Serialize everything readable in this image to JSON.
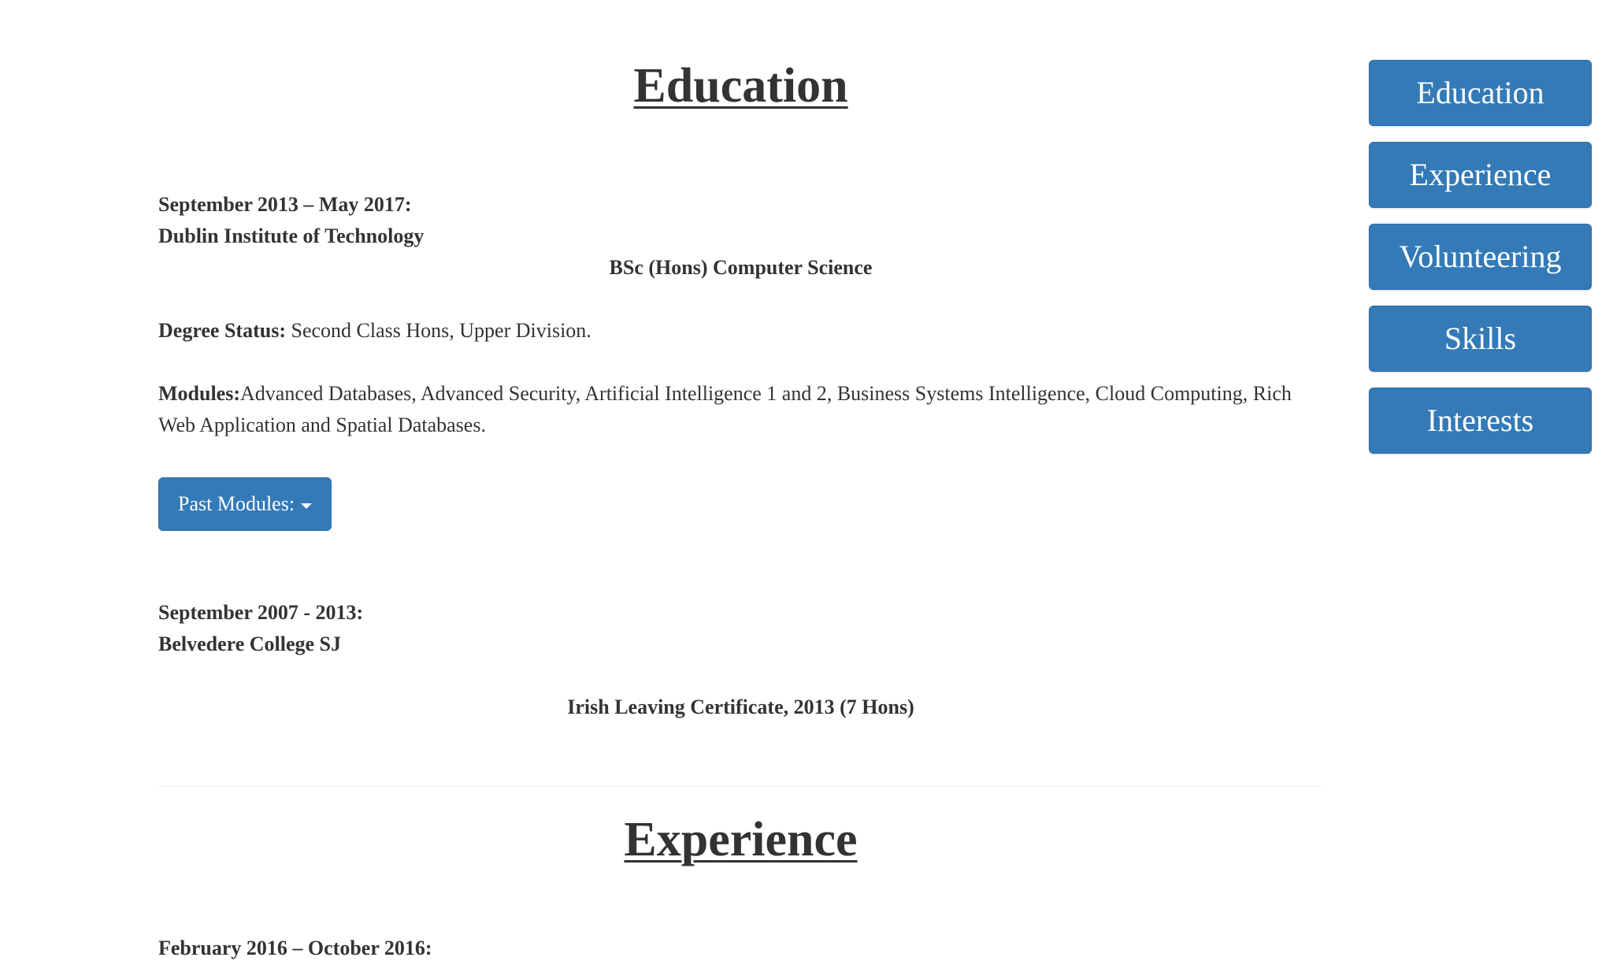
{
  "education": {
    "title": "Education",
    "entry1": {
      "date": "September 2013 – May 2017:",
      "institution": "Dublin Institute of Technology",
      "qualification": "BSc (Hons) Computer Science",
      "status_label": "Degree Status:",
      "status_value": " Second Class Hons, Upper Division.",
      "modules_label": "Modules:",
      "modules_value": "Advanced Databases, Advanced Security, Artificial Intelligence 1 and 2, Business Systems Intelligence, Cloud Computing, Rich Web Application and Spatial Databases.",
      "past_modules_button": "Past Modules:"
    },
    "entry2": {
      "date": "September 2007 - 2013:",
      "institution": "Belvedere College SJ",
      "qualification": "Irish Leaving Certificate, 2013 (7 Hons)"
    }
  },
  "experience": {
    "title": "Experience",
    "entry1": {
      "date": "February 2016 – October 2016:"
    }
  },
  "nav": {
    "items": [
      {
        "label": "Education"
      },
      {
        "label": "Experience"
      },
      {
        "label": "Volunteering"
      },
      {
        "label": "Skills"
      },
      {
        "label": "Interests"
      }
    ]
  },
  "colors": {
    "button_bg": "#337ab7",
    "button_border": "#2e6da4",
    "text": "#333333"
  }
}
